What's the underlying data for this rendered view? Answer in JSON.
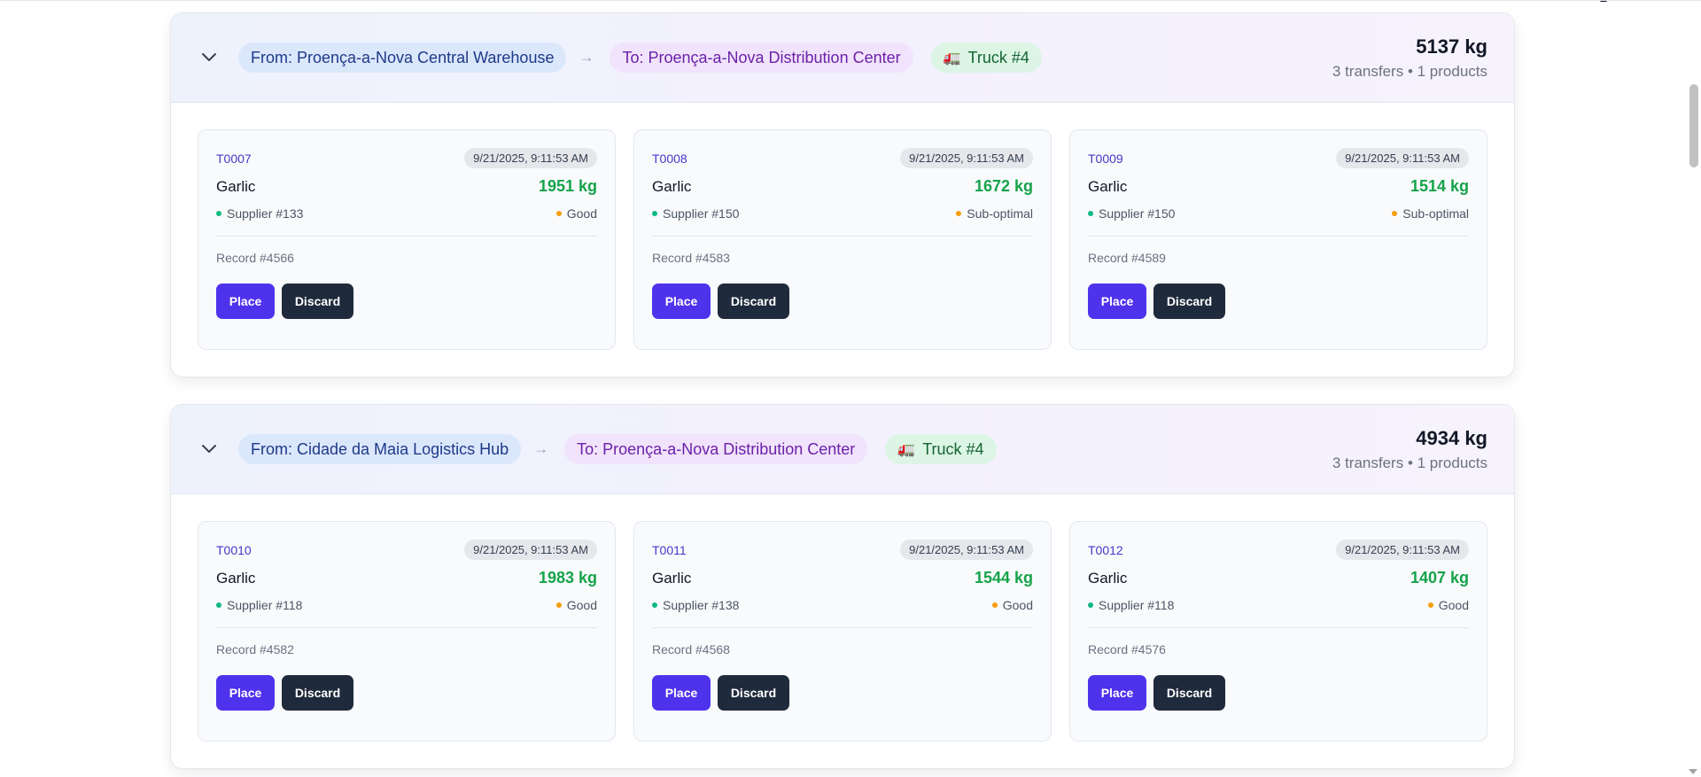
{
  "groups": [
    {
      "from": "From: Proença-a-Nova Central Warehouse",
      "to": "To: Proença-a-Nova Distribution Center",
      "truck": "Truck #4",
      "total": "5137 kg",
      "summary": "3 transfers • 1 products",
      "transfers": [
        {
          "id": "T0007",
          "time": "9/21/2025, 9:11:53 AM",
          "product": "Garlic",
          "qty": "1951 kg",
          "supplier": "Supplier #133",
          "quality": "Good",
          "record": "Record #4566"
        },
        {
          "id": "T0008",
          "time": "9/21/2025, 9:11:53 AM",
          "product": "Garlic",
          "qty": "1672 kg",
          "supplier": "Supplier #150",
          "quality": "Sub-optimal",
          "record": "Record #4583"
        },
        {
          "id": "T0009",
          "time": "9/21/2025, 9:11:53 AM",
          "product": "Garlic",
          "qty": "1514 kg",
          "supplier": "Supplier #150",
          "quality": "Sub-optimal",
          "record": "Record #4589"
        }
      ]
    },
    {
      "from": "From: Cidade da Maia Logistics Hub",
      "to": "To: Proença-a-Nova Distribution Center",
      "truck": "Truck #4",
      "total": "4934 kg",
      "summary": "3 transfers • 1 products",
      "transfers": [
        {
          "id": "T0010",
          "time": "9/21/2025, 9:11:53 AM",
          "product": "Garlic",
          "qty": "1983 kg",
          "supplier": "Supplier #118",
          "quality": "Good",
          "record": "Record #4582"
        },
        {
          "id": "T0011",
          "time": "9/21/2025, 9:11:53 AM",
          "product": "Garlic",
          "qty": "1544 kg",
          "supplier": "Supplier #138",
          "quality": "Good",
          "record": "Record #4568"
        },
        {
          "id": "T0012",
          "time": "9/21/2025, 9:11:53 AM",
          "product": "Garlic",
          "qty": "1407 kg",
          "supplier": "Supplier #118",
          "quality": "Good",
          "record": "Record #4576"
        }
      ]
    }
  ],
  "labels": {
    "arrow": "→",
    "truck_glyph": "🚛",
    "place": "Place",
    "discard": "Discard"
  },
  "icons": {
    "collapse": "chevron-down-icon",
    "route_arrow": "arrow-right-icon",
    "truck": "truck-icon",
    "supplier_status": "status-dot-icon",
    "quality_status": "status-dot-icon"
  },
  "colors": {
    "place_button": "#4f32ec",
    "discard_button": "#1f2a3c",
    "quantity": "#16a34a",
    "transfer_id": "#4338ca",
    "supplier_dot": "#10b981",
    "quality_dot": "#f59e0b",
    "from_pill": "#dbe7fb",
    "to_pill": "#f1e3fb",
    "truck_pill": "#dcf5e5"
  }
}
